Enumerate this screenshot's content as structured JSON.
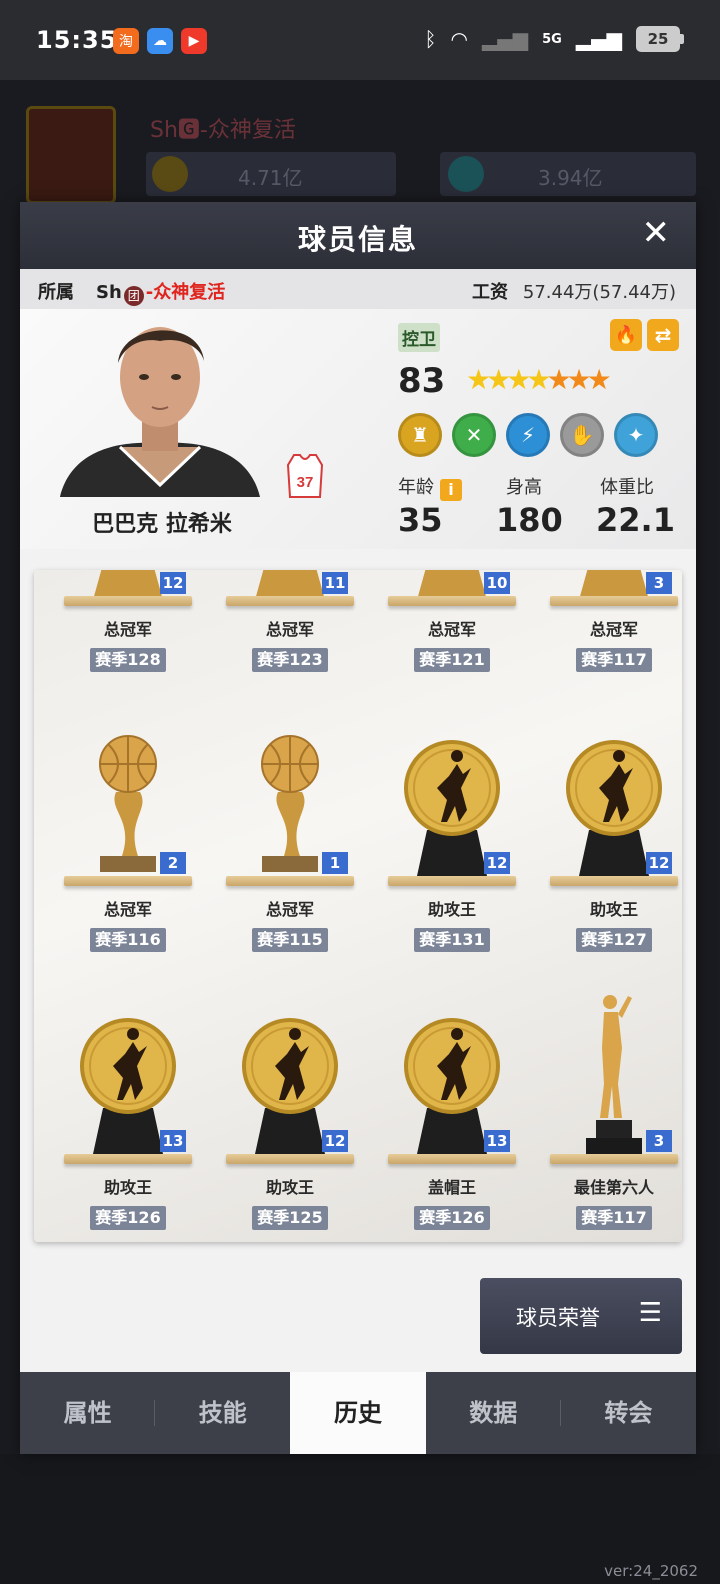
{
  "status_bar": {
    "time": "15:35",
    "battery": "25",
    "network": "5G",
    "apps": [
      {
        "icon": "taobao-icon",
        "color": "#f36b1c"
      },
      {
        "icon": "weather-icon",
        "color": "#3a8ef0"
      },
      {
        "icon": "video-icon",
        "color": "#ef3a2b"
      }
    ]
  },
  "background": {
    "team_name": "Sh🅶-众神复活",
    "coins": "4.71亿",
    "diamonds": "3.94亿",
    "version": "ver:24_2062"
  },
  "modal": {
    "title": "球员信息",
    "close": "✕",
    "team_label": "所属",
    "team_prefix": "Sh",
    "team_icon": "团",
    "team_suffix": "-众神复活",
    "wage_label": "工资",
    "wage_value": "57.44万(57.44万)"
  },
  "player": {
    "name": "巴巴克 拉希米",
    "jersey": "37",
    "position": "控卫",
    "rating": "83",
    "stars_total": 7,
    "stars_gold": 4,
    "age_label": "年龄",
    "age": "35",
    "height_label": "身高",
    "height": "180",
    "weight_label": "体重比",
    "weight": "22.1",
    "badges": [
      {
        "icon": "defender-badge-icon",
        "color": "#d9a520"
      },
      {
        "icon": "x-badge-icon",
        "color": "#3fae4a"
      },
      {
        "icon": "lightning-badge-icon",
        "color": "#2d8fd6"
      },
      {
        "icon": "gray-badge-icon",
        "color": "#9a9a9a"
      },
      {
        "icon": "blue-badge-icon",
        "color": "#3fa2d8"
      }
    ]
  },
  "trophies": [
    {
      "name": "总冠军",
      "count": "12",
      "season": "赛季128",
      "type": "cup"
    },
    {
      "name": "总冠军",
      "count": "11",
      "season": "赛季123",
      "type": "cup"
    },
    {
      "name": "总冠军",
      "count": "10",
      "season": "赛季121",
      "type": "cup"
    },
    {
      "name": "总冠军",
      "count": "3",
      "season": "赛季117",
      "type": "cup"
    },
    {
      "name": "总冠军",
      "count": "2",
      "season": "赛季116",
      "type": "ball"
    },
    {
      "name": "总冠军",
      "count": "1",
      "season": "赛季115",
      "type": "ball"
    },
    {
      "name": "助攻王",
      "count": "12",
      "season": "赛季131",
      "type": "disc"
    },
    {
      "name": "助攻王",
      "count": "12",
      "season": "赛季127",
      "type": "disc"
    },
    {
      "name": "助攻王",
      "count": "13",
      "season": "赛季126",
      "type": "disc"
    },
    {
      "name": "助攻王",
      "count": "12",
      "season": "赛季125",
      "type": "disc"
    },
    {
      "name": "盖帽王",
      "count": "13",
      "season": "赛季126",
      "type": "disc"
    },
    {
      "name": "最佳第六人",
      "count": "3",
      "season": "赛季117",
      "type": "figure"
    }
  ],
  "honor_button": {
    "label": "球员荣誉",
    "icon": "☰"
  },
  "tabs": [
    {
      "label": "属性",
      "active": false
    },
    {
      "label": "技能",
      "active": false
    },
    {
      "label": "历史",
      "active": true
    },
    {
      "label": "数据",
      "active": false
    },
    {
      "label": "转会",
      "active": false
    }
  ]
}
